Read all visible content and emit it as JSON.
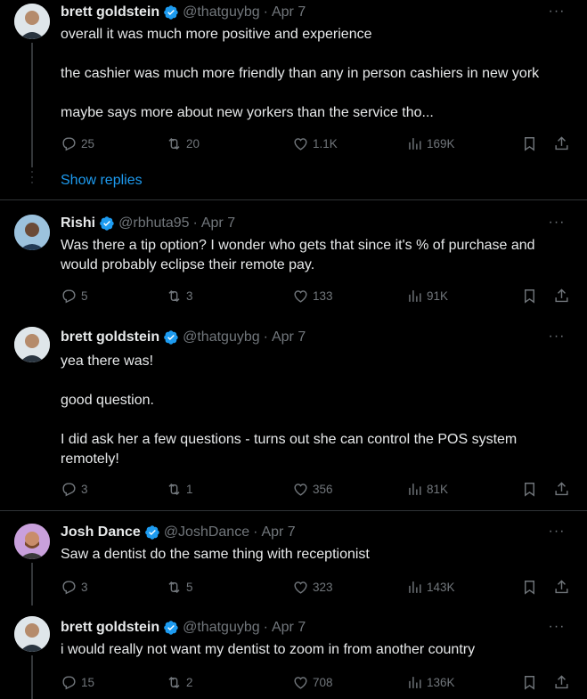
{
  "tweets": [
    {
      "name": "brett goldstein",
      "handle": "@thatguybg",
      "date": "Apr 7",
      "lines": [
        "overall it was much more positive and experience",
        "the cashier was much more friendly than any in person cashiers in new york",
        "maybe says more about new yorkers than the service tho..."
      ],
      "replies": "25",
      "retweets": "20",
      "likes": "1.1K",
      "views": "169K",
      "avatar_color": "#dfe6ea"
    },
    {
      "name": "Rishi",
      "handle": "@rbhuta95",
      "date": "Apr 7",
      "lines": [
        "Was there a tip option? I wonder who gets that since it's % of purchase and would probably eclipse their remote pay."
      ],
      "replies": "5",
      "retweets": "3",
      "likes": "133",
      "views": "91K",
      "avatar_color": "#7aa7c7"
    },
    {
      "name": "brett goldstein",
      "handle": "@thatguybg",
      "date": "Apr 7",
      "lines": [
        "yea there was!",
        "good question.",
        "I did ask her a few questions - turns out she can control the POS system remotely!"
      ],
      "replies": "3",
      "retweets": "1",
      "likes": "356",
      "views": "81K",
      "avatar_color": "#dfe6ea"
    },
    {
      "name": "Josh Dance",
      "handle": "@JoshDance",
      "date": "Apr 7",
      "lines": [
        "Saw a dentist do the same thing with receptionist"
      ],
      "replies": "3",
      "retweets": "5",
      "likes": "323",
      "views": "143K",
      "avatar_color": "#c9a0dc"
    },
    {
      "name": "brett goldstein",
      "handle": "@thatguybg",
      "date": "Apr 7",
      "lines": [
        "i would really not want my dentist to zoom in from another country"
      ],
      "replies": "15",
      "retweets": "2",
      "likes": "708",
      "views": "136K",
      "avatar_color": "#dfe6ea"
    }
  ],
  "show_replies_label": "Show replies",
  "more_label": "···",
  "colors": {
    "accent": "#1d9bf0",
    "muted": "#71767b",
    "text": "#e7e9ea",
    "divider": "#2f3336"
  },
  "icons": [
    "verified-badge-icon",
    "reply-icon",
    "retweet-icon",
    "like-icon",
    "views-icon",
    "bookmark-icon",
    "share-icon",
    "more-icon"
  ]
}
